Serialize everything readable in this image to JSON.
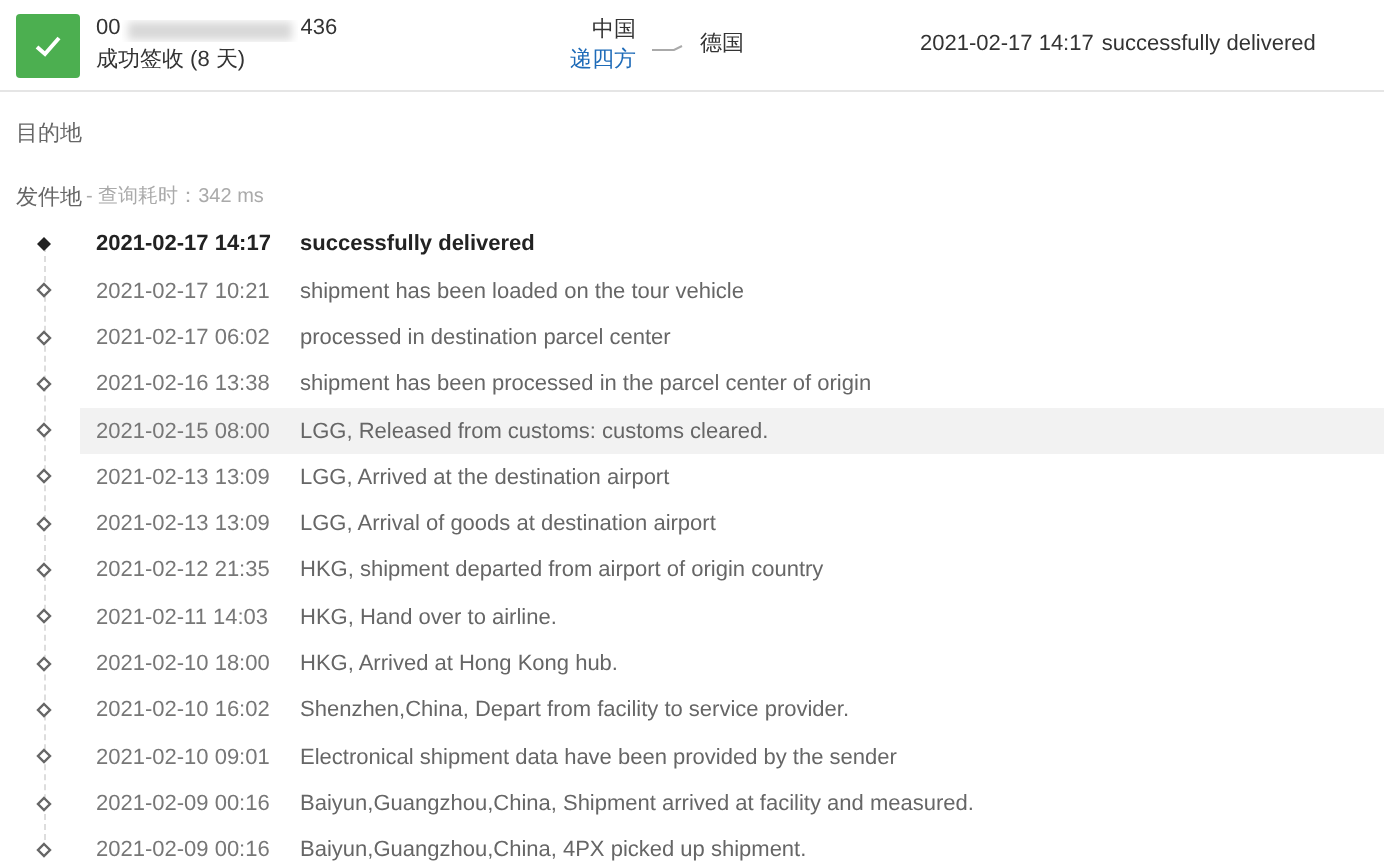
{
  "header": {
    "tracking_number_start": "00",
    "tracking_number_end": "436",
    "status": "成功签收 (8 天)",
    "origin_country": "中国",
    "carrier": "递四方",
    "destination_country": "德国",
    "latest_time": "2021-02-17 14:17",
    "latest_event": "successfully delivered"
  },
  "destination_label": "目的地",
  "origin_label": "发件地",
  "query_time": "- 查询耗时：342 ms",
  "events": [
    {
      "time": "2021-02-17 14:17",
      "text": "successfully delivered",
      "latest": true,
      "selected": false
    },
    {
      "time": "2021-02-17 10:21",
      "text": "shipment has been loaded on the tour vehicle",
      "latest": false,
      "selected": false
    },
    {
      "time": "2021-02-17 06:02",
      "text": "processed in destination parcel center",
      "latest": false,
      "selected": false
    },
    {
      "time": "2021-02-16 13:38",
      "text": "shipment has been processed in the parcel center of origin",
      "latest": false,
      "selected": false
    },
    {
      "time": "2021-02-15 08:00",
      "text": "LGG, Released from customs: customs cleared.",
      "latest": false,
      "selected": true
    },
    {
      "time": "2021-02-13 13:09",
      "text": "LGG, Arrived at the destination airport",
      "latest": false,
      "selected": false
    },
    {
      "time": "2021-02-13 13:09",
      "text": "LGG, Arrival of goods at destination airport",
      "latest": false,
      "selected": false
    },
    {
      "time": "2021-02-12 21:35",
      "text": "HKG, shipment departed from airport of origin country",
      "latest": false,
      "selected": false
    },
    {
      "time": "2021-02-11 14:03",
      "text": "HKG, Hand over to airline.",
      "latest": false,
      "selected": false
    },
    {
      "time": "2021-02-10 18:00",
      "text": "HKG, Arrived at Hong Kong hub.",
      "latest": false,
      "selected": false
    },
    {
      "time": "2021-02-10 16:02",
      "text": "Shenzhen,China, Depart from facility to service provider.",
      "latest": false,
      "selected": false
    },
    {
      "time": "2021-02-10 09:01",
      "text": "Electronical shipment data have been provided by the sender",
      "latest": false,
      "selected": false
    },
    {
      "time": "2021-02-09 00:16",
      "text": "Baiyun,Guangzhou,China, Shipment arrived at facility and measured.",
      "latest": false,
      "selected": false
    },
    {
      "time": "2021-02-09 00:16",
      "text": "Baiyun,Guangzhou,China, 4PX picked up shipment.",
      "latest": false,
      "selected": false
    }
  ]
}
